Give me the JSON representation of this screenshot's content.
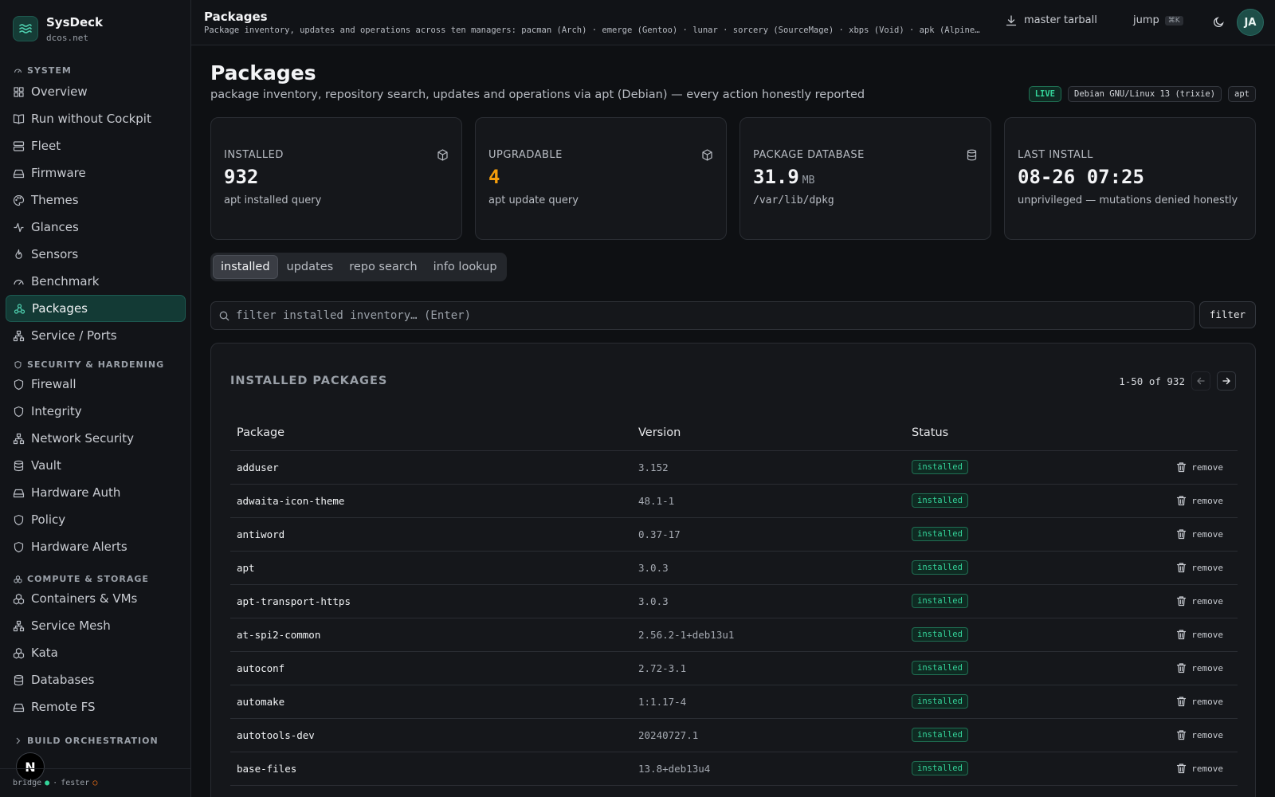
{
  "brand": {
    "name": "SysDeck",
    "host": "dcos.net"
  },
  "sidebar": {
    "sections": [
      {
        "title": "SYSTEM",
        "items": [
          "Overview",
          "Run without Cockpit",
          "Fleet",
          "Firmware",
          "Themes",
          "Glances",
          "Sensors",
          "Benchmark",
          "Packages",
          "Service / Ports"
        ]
      },
      {
        "title": "SECURITY & HARDENING",
        "items": [
          "Firewall",
          "Integrity",
          "Network Security",
          "Vault",
          "Hardware Auth",
          "Policy",
          "Hardware Alerts"
        ]
      },
      {
        "title": "COMPUTE & STORAGE",
        "items": [
          "Containers & VMs",
          "Service Mesh",
          "Kata",
          "Databases",
          "Remote FS"
        ]
      },
      {
        "title": "BUILD ORCHESTRATION",
        "items": []
      }
    ],
    "active": "Packages",
    "footer": {
      "bridge": "bridge",
      "fester": "fester",
      "separator": "·"
    },
    "n_badge": "N"
  },
  "topbar": {
    "title": "Packages",
    "subtitle": "Package inventory, updates and operations across ten managers: pacman (Arch) · emerge (Gentoo) · lunar · sorcery (SourceMage) · xbps (Void) · apk (Alpine) · zypper (openSUSE) · dnf",
    "tarball_label": "master tarball",
    "jump_label": "jump",
    "jump_kbd": "⌘K",
    "avatar": "JA"
  },
  "page": {
    "title": "Packages",
    "subtitle": "package inventory, repository search, updates and operations via apt (Debian) — every action honestly reported",
    "tags": {
      "live": "LIVE",
      "os": "Debian GNU/Linux 13 (trixie)",
      "manager": "apt"
    }
  },
  "cards": [
    {
      "label": "INSTALLED",
      "value": "932",
      "unit": "",
      "note": "apt installed query",
      "icon": "box-icon"
    },
    {
      "label": "UPGRADABLE",
      "value": "4",
      "unit": "",
      "note": "apt update query",
      "icon": "box-icon"
    },
    {
      "label": "PACKAGE DATABASE",
      "value": "31.9",
      "unit": "MB",
      "note": "/var/lib/dpkg",
      "icon": "database-icon"
    },
    {
      "label": "LAST INSTALL",
      "value": "08-26 07:25",
      "unit": "",
      "note": "unprivileged — mutations denied honestly",
      "icon": ""
    }
  ],
  "tabs": [
    "installed",
    "updates",
    "repo search",
    "info lookup"
  ],
  "search": {
    "placeholder": "filter installed inventory… (Enter)",
    "value": "",
    "button": "filter"
  },
  "table": {
    "title": "INSTALLED PACKAGES",
    "range": "1-50 of 932",
    "columns": [
      "Package",
      "Version",
      "Status"
    ],
    "remove_label": "remove",
    "rows": [
      {
        "name": "adduser",
        "version": "3.152",
        "status": "installed"
      },
      {
        "name": "adwaita-icon-theme",
        "version": "48.1-1",
        "status": "installed"
      },
      {
        "name": "antiword",
        "version": "0.37-17",
        "status": "installed"
      },
      {
        "name": "apt",
        "version": "3.0.3",
        "status": "installed"
      },
      {
        "name": "apt-transport-https",
        "version": "3.0.3",
        "status": "installed"
      },
      {
        "name": "at-spi2-common",
        "version": "2.56.2-1+deb13u1",
        "status": "installed"
      },
      {
        "name": "autoconf",
        "version": "2.72-3.1",
        "status": "installed"
      },
      {
        "name": "automake",
        "version": "1:1.17-4",
        "status": "installed"
      },
      {
        "name": "autotools-dev",
        "version": "20240727.1",
        "status": "installed"
      },
      {
        "name": "base-files",
        "version": "13.8+deb13u4",
        "status": "installed"
      }
    ]
  },
  "colors": {
    "accent": "#34d399",
    "warn": "#f59e0b",
    "background": "#0e1013"
  }
}
